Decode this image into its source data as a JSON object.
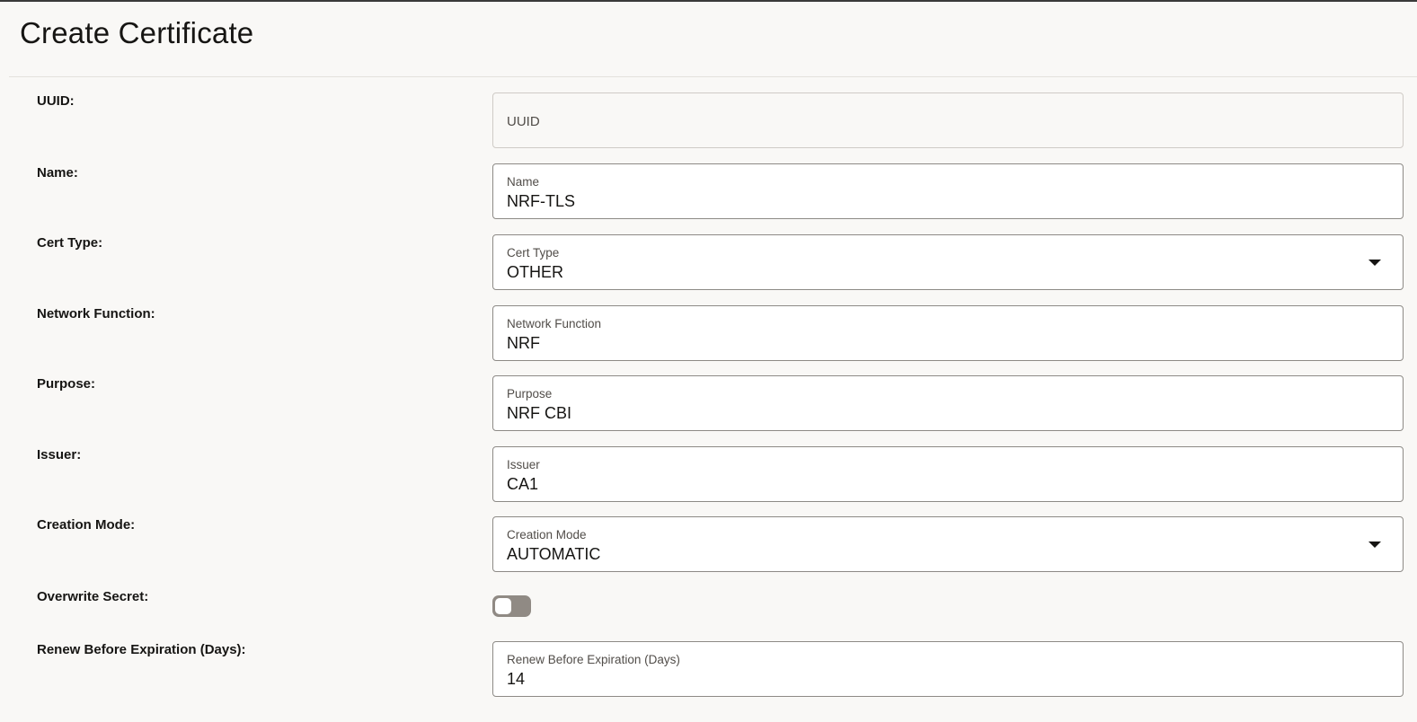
{
  "header": {
    "title": "Create Certificate"
  },
  "form": {
    "uuid": {
      "label": "UUID:",
      "placeholder": "UUID"
    },
    "name": {
      "label": "Name:",
      "caption": "Name",
      "value": "NRF-TLS"
    },
    "cert_type": {
      "label": "Cert Type:",
      "caption": "Cert Type",
      "value": "OTHER",
      "icon": "chevron-down-icon"
    },
    "network_function": {
      "label": "Network Function:",
      "caption": "Network Function",
      "value": "NRF"
    },
    "purpose": {
      "label": "Purpose:",
      "caption": "Purpose",
      "value": "NRF CBI"
    },
    "issuer": {
      "label": "Issuer:",
      "caption": "Issuer",
      "value": "CA1"
    },
    "creation_mode": {
      "label": "Creation Mode:",
      "caption": "Creation Mode",
      "value": "AUTOMATIC",
      "icon": "chevron-down-icon"
    },
    "overwrite_secret": {
      "label": "Overwrite Secret:",
      "checked": false
    },
    "renew_before_expiration": {
      "label": "Renew Before Expiration (Days):",
      "caption": "Renew Before Expiration (Days)",
      "value": "14"
    }
  },
  "colors": {
    "background": "#f9f8f6",
    "field_border": "#8d8a86",
    "toggle_off": "#908a84",
    "text": "#161513",
    "caption": "#514d49"
  }
}
